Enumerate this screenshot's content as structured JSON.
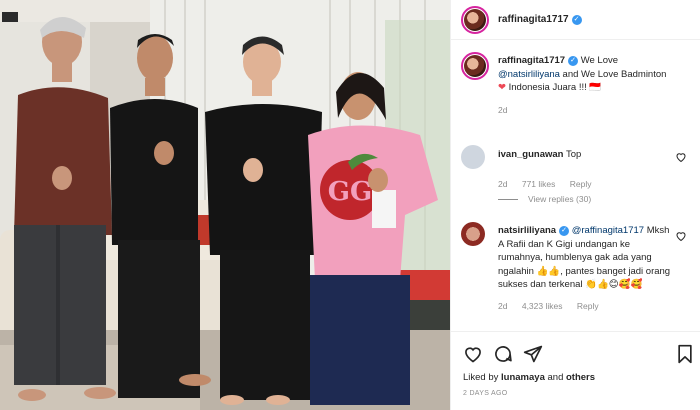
{
  "post": {
    "username": "raffinagita1717",
    "verified_mark": "✓"
  },
  "caption": {
    "username": "raffinagita1717",
    "text_before": "We Love ",
    "mention": "@natsirliliyana",
    "text_after": " and We Love Badminton",
    "heart": "❤",
    "text_end": " Indonesia Juara !!! 🇮🇩",
    "time": "2d"
  },
  "comment1": {
    "username": "ivan_gunawan",
    "text": "Top",
    "time": "2d",
    "likes": "771 likes",
    "reply": "Reply"
  },
  "view_replies": "View replies (30)",
  "comment2": {
    "username": "natsirliliyana",
    "mention": "@raffinagita1717",
    "text": "Mksh A Rafii dan K Gigi undangan ke rumahnya, humblenya gak ada yang ngalahin 👍👍, pantes banget jadi orang sukses dan terkenal 👏👍😊🥰🥰",
    "time": "2d",
    "likes": "4,323 likes",
    "reply": "Reply"
  },
  "liked_by": {
    "prefix": "Liked by ",
    "user": "lunamaya",
    "suffix": " and ",
    "others": "others"
  },
  "timestamp": "2 DAYS AGO",
  "icons": {
    "like": "heart-icon",
    "comment": "comment-icon",
    "share": "share-icon",
    "save": "bookmark-icon"
  },
  "colors": {
    "verified": "#3897f0",
    "mention": "#00376b",
    "muted": "#8e8e8e",
    "heart": "#ed4956",
    "shirt_pink": "#f2a0bd"
  }
}
